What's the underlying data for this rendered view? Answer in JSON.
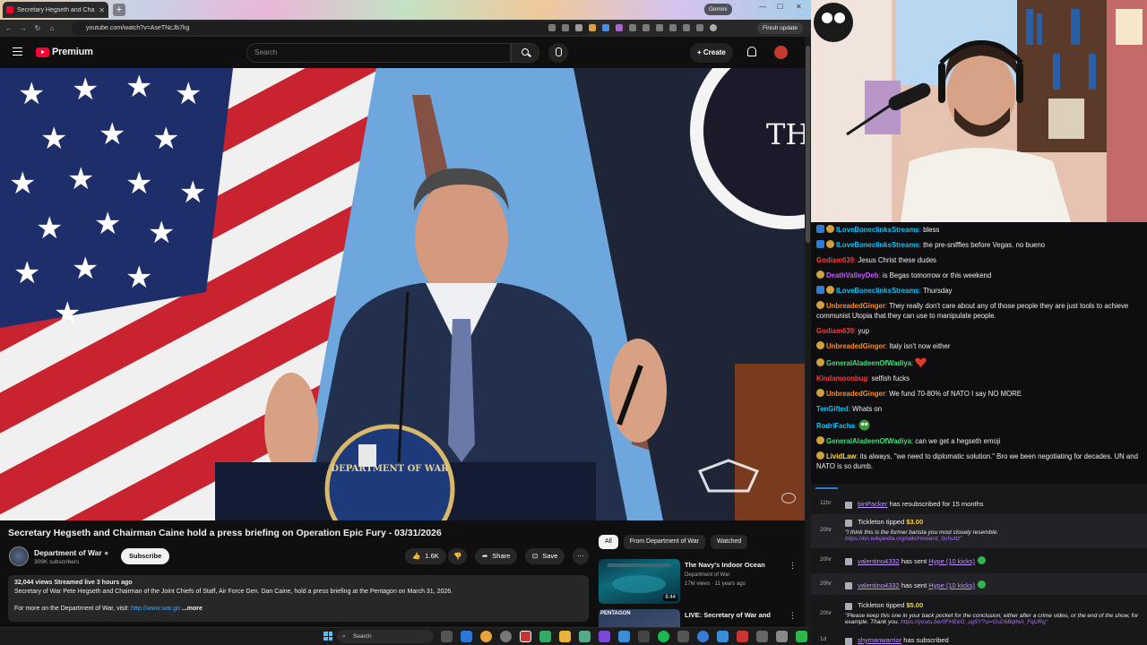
{
  "browser": {
    "tab_title": "Secretary Hegseth and Cha",
    "new_tab": "+",
    "gemini_label": "Gemini",
    "url": "youtube.com/watch?v=AseTNcJb7kg",
    "finish_update": "Finish update"
  },
  "youtube": {
    "brand": "Premium",
    "search_placeholder": "Search",
    "create_label": "Create",
    "video": {
      "title": "Secretary Hegseth and Chairman Caine hold a press briefing on Operation Epic Fury - 03/31/2026",
      "channel": "Department of War",
      "subscribers": "309K subscribers",
      "subscribe_label": "Subscribe",
      "likes": "1.6K",
      "share_label": "Share",
      "save_label": "Save",
      "more_icon": "⋯",
      "description_meta": "32,044 views  Streamed live 3 hours ago",
      "description_line1": "Secretary of War Pete Hegseth and Chairman of the Joint Chiefs of Staff, Air Force Gen. Dan Caine, hold a press briefing at the Pentagon on March 31, 2026.",
      "description_line2": "For more on the Department of War, visit:",
      "description_link": "http://www.war.go",
      "description_more": "...more",
      "podium_text": "DEPARTMENT OF WAR",
      "backdrop_text": "TH"
    },
    "chips": [
      "All",
      "From Department of War",
      "Watched"
    ],
    "recommendations": [
      {
        "title": "The Navy's Indoor Ocean",
        "channel": "Department of War",
        "views": "17M views · 11 years ago",
        "duration": "8:44"
      },
      {
        "title": "LIVE: Secretary of War and",
        "channel": "",
        "views": "",
        "duration": "",
        "thumb_text": "PENTAGON"
      }
    ]
  },
  "chat": [
    {
      "user": "ILoveBoneclinksStreams",
      "color": "#00c8ff",
      "badges": [
        "blue",
        "gold"
      ],
      "text": "bless"
    },
    {
      "user": "ILoveBoneclinksStreams",
      "color": "#00c8ff",
      "badges": [
        "blue",
        "gold"
      ],
      "text": "the pre-sniffles before Vegas. no bueno"
    },
    {
      "user": "Godiam639",
      "color": "#ff3a3a",
      "badges": [],
      "text": "Jesus Christ these dudes"
    },
    {
      "user": "DeathValleyDeb",
      "color": "#c35cff",
      "badges": [
        "gold"
      ],
      "text": "is Begas tomorrow or this weekend"
    },
    {
      "user": "ILoveBoneclinksStreams",
      "color": "#00c8ff",
      "badges": [
        "blue",
        "gold"
      ],
      "text": "Thursday"
    },
    {
      "user": "UnbreadedGinger",
      "color": "#ff8c1a",
      "badges": [
        "gold"
      ],
      "text": "They really don't care about any of those people they are just tools to achieve communist Utopia that they can use to manipulate people."
    },
    {
      "user": "Godiam639",
      "color": "#ff3a3a",
      "badges": [],
      "text": "yup"
    },
    {
      "user": "UnbreadedGinger",
      "color": "#ff8c1a",
      "badges": [
        "gold"
      ],
      "text": "Italy isn't now either"
    },
    {
      "user": "GeneralAladeenOfWadiya",
      "color": "#3fe07a",
      "badges": [
        "gold"
      ],
      "text": "",
      "emote": "heart"
    },
    {
      "user": "Kindamoonbug",
      "color": "#ff3a3a",
      "badges": [],
      "text": "selfish fucks"
    },
    {
      "user": "UnbreadedGinger",
      "color": "#ff8c1a",
      "badges": [
        "gold"
      ],
      "text": "We fund 70-80% of NATO I say NO MORE"
    },
    {
      "user": "TenGifted",
      "color": "#00c8ff",
      "badges": [],
      "text": "Whats on"
    },
    {
      "user": "RodriFacha",
      "color": "#00c8ff",
      "badges": [],
      "text": "",
      "emote": "face"
    },
    {
      "user": "GeneralAladeenOfWadiya",
      "color": "#3fe07a",
      "badges": [
        "gold"
      ],
      "text": "can we get a hegseth emoji"
    },
    {
      "user": "LividLaw",
      "color": "#ffd84a",
      "badges": [
        "gold"
      ],
      "text": "its always, \"we need to diplomatic solution.\" Bro we been negotiating for decades. UN and NATO is so dumb."
    }
  ],
  "activity": [
    {
      "time": "11hr",
      "name": "binPacker",
      "text": "has resubscribed for 15 months"
    },
    {
      "time": "20hr",
      "name": "Tickleton",
      "text": "tipped",
      "amount": "$3.00",
      "message": "\"I think this is the former barista you most closely resemble:",
      "link": "https://en.wikipedia.org/wiki/Howard_Schultz\""
    },
    {
      "time": "20hr",
      "name": "valentino4332",
      "text": "has sent",
      "hype": "Hype (10 kicks)"
    },
    {
      "time": "20hr",
      "name": "valentino4332",
      "text": "has sent",
      "hype": "Hype (10 kicks)"
    },
    {
      "time": "20hr",
      "name": "Tickleton",
      "text": "tipped",
      "amount": "$5.00",
      "message": "\"Please keep this one in your back pocket for the conclusion; either after a crime video, or the end of the show, for example. Thank you.",
      "link": "https://youtu.be/0FHEeG_ug5Y?si=GsD6BqlNA_FqURg\""
    },
    {
      "time": "1d",
      "name": "shymanwarrior",
      "text": "has subscribed"
    }
  ],
  "taskbar": {
    "search_label": "Search"
  },
  "colors": {
    "yt_red": "#ff0033",
    "twitch_purple": "#a970ff",
    "link_blue": "#3ea6ff"
  }
}
